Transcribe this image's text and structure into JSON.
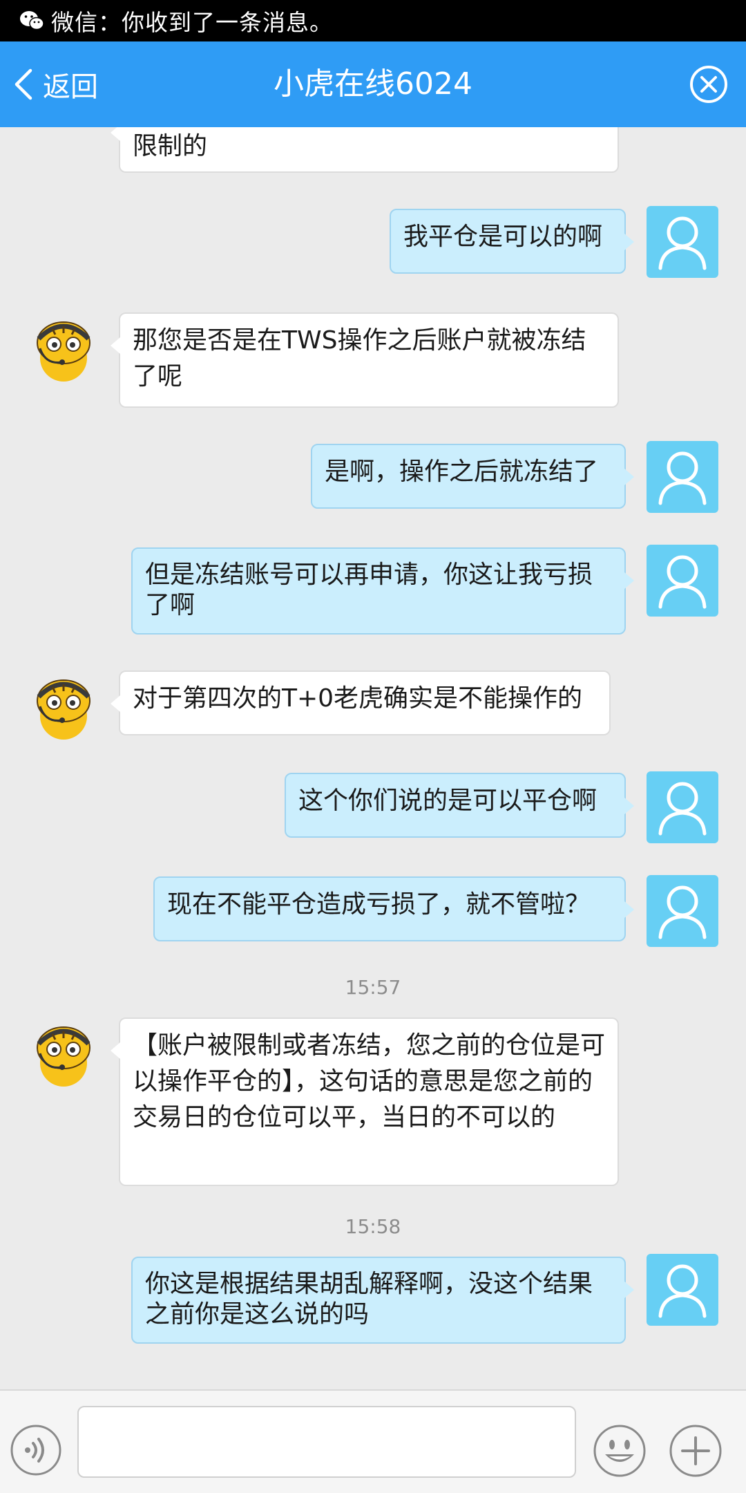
{
  "status_bar": {
    "notification_icon": "wechat-icon",
    "notification_text": "微信：你收到了一条消息。"
  },
  "header": {
    "back_label": "返回",
    "title": "小虎在线6024",
    "close_icon": "close-circle-icon"
  },
  "chat": {
    "messages": [
      {
        "from": "service",
        "text": "限制的"
      },
      {
        "from": "me",
        "text": "我平仓是可以的啊"
      },
      {
        "from": "service",
        "text": "那您是否是在TWS操作之后账户就被冻结了呢"
      },
      {
        "from": "me",
        "text": "是啊，操作之后就冻结了"
      },
      {
        "from": "me",
        "text": "但是冻结账号可以再申请，你这让我亏损了啊"
      },
      {
        "from": "service",
        "text": "对于第四次的T+0老虎确实是不能操作的"
      },
      {
        "from": "me",
        "text": "这个你们说的是可以平仓啊"
      },
      {
        "from": "me",
        "text": "现在不能平仓造成亏损了，就不管啦？"
      },
      {
        "from": "time",
        "text": "15:57"
      },
      {
        "from": "service",
        "text": "【账户被限制或者冻结，您之前的仓位是可以操作平仓的】，这句话的意思是您之前的交易日的仓位可以平，当日的不可以的"
      },
      {
        "from": "time",
        "text": "15:58"
      },
      {
        "from": "me",
        "text": "你这是根据结果胡乱解释啊，没这个结果之前你是这么说的吗"
      }
    ]
  },
  "input_bar": {
    "voice_icon": "voice-icon",
    "text_value": "",
    "emoji_icon": "emoji-icon",
    "plus_icon": "plus-icon"
  },
  "colors": {
    "header_bg": "#2f9cf5",
    "my_bubble": "#cbeefd",
    "service_bubble": "#ffffff",
    "user_avatar": "#67cff4",
    "chat_bg": "#ebebeb"
  }
}
